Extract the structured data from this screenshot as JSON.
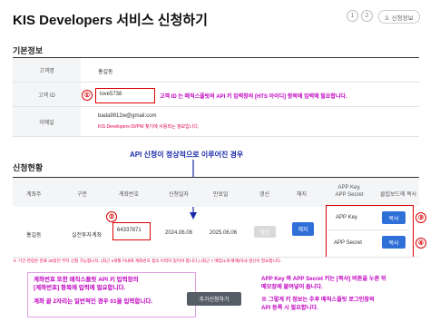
{
  "header": {
    "title": "KIS Developers 서비스 신청하기",
    "steps": [
      "1",
      "2"
    ],
    "active_step": "3. 신청정보"
  },
  "basic_info": {
    "section_title": "기본정보",
    "rows": [
      {
        "label": "고객명",
        "value": "홍길동"
      },
      {
        "label": "고객 ID",
        "value": "love5738"
      },
      {
        "label": "이메일",
        "value": "bada9912w@gmail.com",
        "sub": "KIS Developers ID/PW 찾기에 사용되는 정보입니다."
      }
    ],
    "annotation_num": "①",
    "annotation": "고객 ID 는 매직스플릿의 API 키 입력창의 [HTS 아이디] 항목에 입력에 필요합니다."
  },
  "success_note": "API 신청이 정상적으로 이루어진 경우",
  "status": {
    "section_title": "신청현황",
    "headers": [
      "계좌주",
      "구분",
      "계좌번호",
      "신청일자",
      "만료일",
      "갱신",
      "해지",
      "APP Key,\nAPP Secret",
      "클립보드에 복사"
    ],
    "row": {
      "owner": "홍길동",
      "type": "실전투자계좌",
      "account": "64337871",
      "apply_date": "2024.06.06",
      "expire_date": "2025.06.06",
      "renew_label": "갱신",
      "cancel_label": "해지",
      "app_key_label": "APP Key",
      "app_secret_label": "APP Secret",
      "copy_label": "복사"
    },
    "footnote": "※ 기간 연장은 만료 30일전 부터 신청 가능합니다. (최근 3개월 이내에 계좌번호 접속 이력이 있어야 합니다.) (최근 7 매입/1개 매매(이내 갱신이 필요합니다."
  },
  "annotations": {
    "num2": "②",
    "num3": "③",
    "num4": "④",
    "note_left": [
      "계좌번호 또한 매직스플릿 API 키 입력창의",
      "[계좌번호] 항목에 입력에 필요합니다.",
      "",
      "계좌 끝 2자리는 일반적인 경우 01을 입력합니다."
    ],
    "note_right": [
      "APP Key 와 APP Secret 키는 [복사] 버튼을 누른 뒤",
      "메모장에 붙여넣어 둡니다.",
      "",
      "※ 그렇게 키 정보는 추후 매직스플릿 로그인창의",
      "API 등록 시 필요합니다."
    ]
  },
  "add_button": "추가신청하기",
  "colors": {
    "accent": "#2f6fd8",
    "annotation_red": "#e00000",
    "note_magenta": "#c000c0"
  }
}
